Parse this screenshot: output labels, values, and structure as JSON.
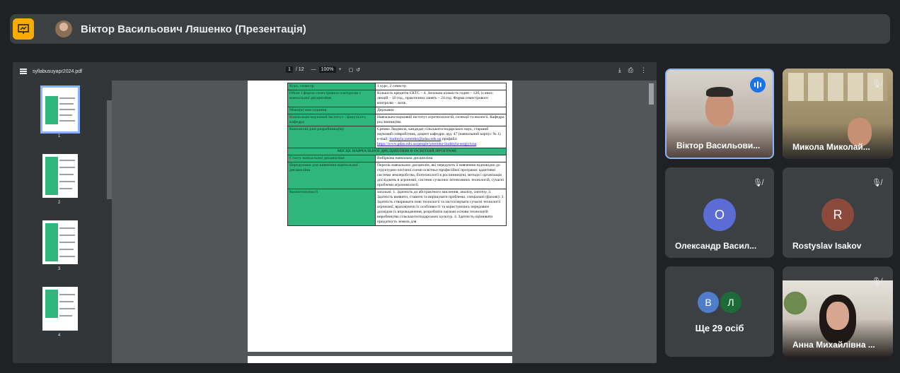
{
  "header": {
    "presenter_title": "Віктор Васильович Ляшенко (Презентація)"
  },
  "pdf": {
    "filename": "syllabusuyapr2024.pdf",
    "page_current": "1",
    "page_total": "/ 12",
    "zoom": "100%",
    "thumb_numbers": [
      "1",
      "2",
      "3",
      "4"
    ]
  },
  "document": {
    "rows": [
      {
        "label": "Курс, семестр",
        "value": "1 курс, 2 семестр"
      },
      {
        "label": "Обсяг і форма семестрового контролю з навчальної дисципліни",
        "value": "Кількість кредитів ЄКТС – 4. Загальна кількість годин – 120, із яких: лекцій – 16 год., практичних занять – 24 год. Форма семестрового контролю – залік."
      },
      {
        "label": "Мова(и) викладання",
        "value": "Державна"
      },
      {
        "label": "Навчально-науковий інститут / факультет, кафедра",
        "value": "Навчально-науковий інститут агротехнологій, селекції та екології. Кафедра рослинництва"
      },
      {
        "label": "Контактні дані розробника(ів)",
        "value": "Єремко Людмила, кандидат сільськогосподарських наук, старший науковий співробітник, доцент кафедри. ауд. 47 (навчальний корпус № 1) e-mail:",
        "email": "liudmyla.yeremko@pdau.edu.ua",
        "profile_label": "профайл:",
        "profile_link": "https://www.pdau.edu.ua/people/yeremko-liudmyla-sergiyivna"
      },
      {
        "section": "МІСЦЕ НАВЧАЛЬНОЇ ДИСЦИПЛІНИ В ОСВІТНІЙ ПРОГРАМІ"
      },
      {
        "label": "Статус навчальної дисципліни",
        "value": "Вибіркова навчальна дисципліна"
      },
      {
        "label": "Передумови для вивчення навчальної дисципліни",
        "value": "Перелік навчальних дисциплін, які передують її вивченню відповідно до структурно-логічної схеми освітньо-професійної програми: адаптивні системи землеробства, біотехнології в рослинництві, методи і організація досліджень в агрономії, системи сучасних інтенсивних технологій, сучасні проблеми агрономології."
      },
      {
        "label": "Компетентності",
        "value": "загальні: 1. Здатність до абстрактного мислення, аналізу, синтезу. 3. Здатність виявити, ставити та вирішувати проблеми. спеціальні (фахові): 3. Здатність створювати нові технології та застосовувати сучасні технології агрономії, враховуючи їх особливості та користуючись передовим досвідом їх впровадження, розробляти наукові основи технологій виробництва сільськогосподарських культур. 4. Здатність оцінювати придатність земель для"
      }
    ]
  },
  "participants": [
    {
      "name": "Віктор Васильови...",
      "type": "video",
      "speaking": true
    },
    {
      "name": "Микола Миколай...",
      "type": "video",
      "muted": true
    },
    {
      "name": "Олександр Васил...",
      "initial": "О",
      "color": "#5b6cd6",
      "muted": true
    },
    {
      "name": "Rostyslav Isakov",
      "initial": "R",
      "color": "#8c4a3d",
      "muted": true
    },
    {
      "name": "Ще 29 осіб",
      "initials": [
        "В",
        "Л"
      ],
      "colors": [
        "#4f7dc9",
        "#1e6b3a"
      ]
    },
    {
      "name": "Анна Михайлівна ...",
      "type": "video",
      "muted": true
    }
  ]
}
